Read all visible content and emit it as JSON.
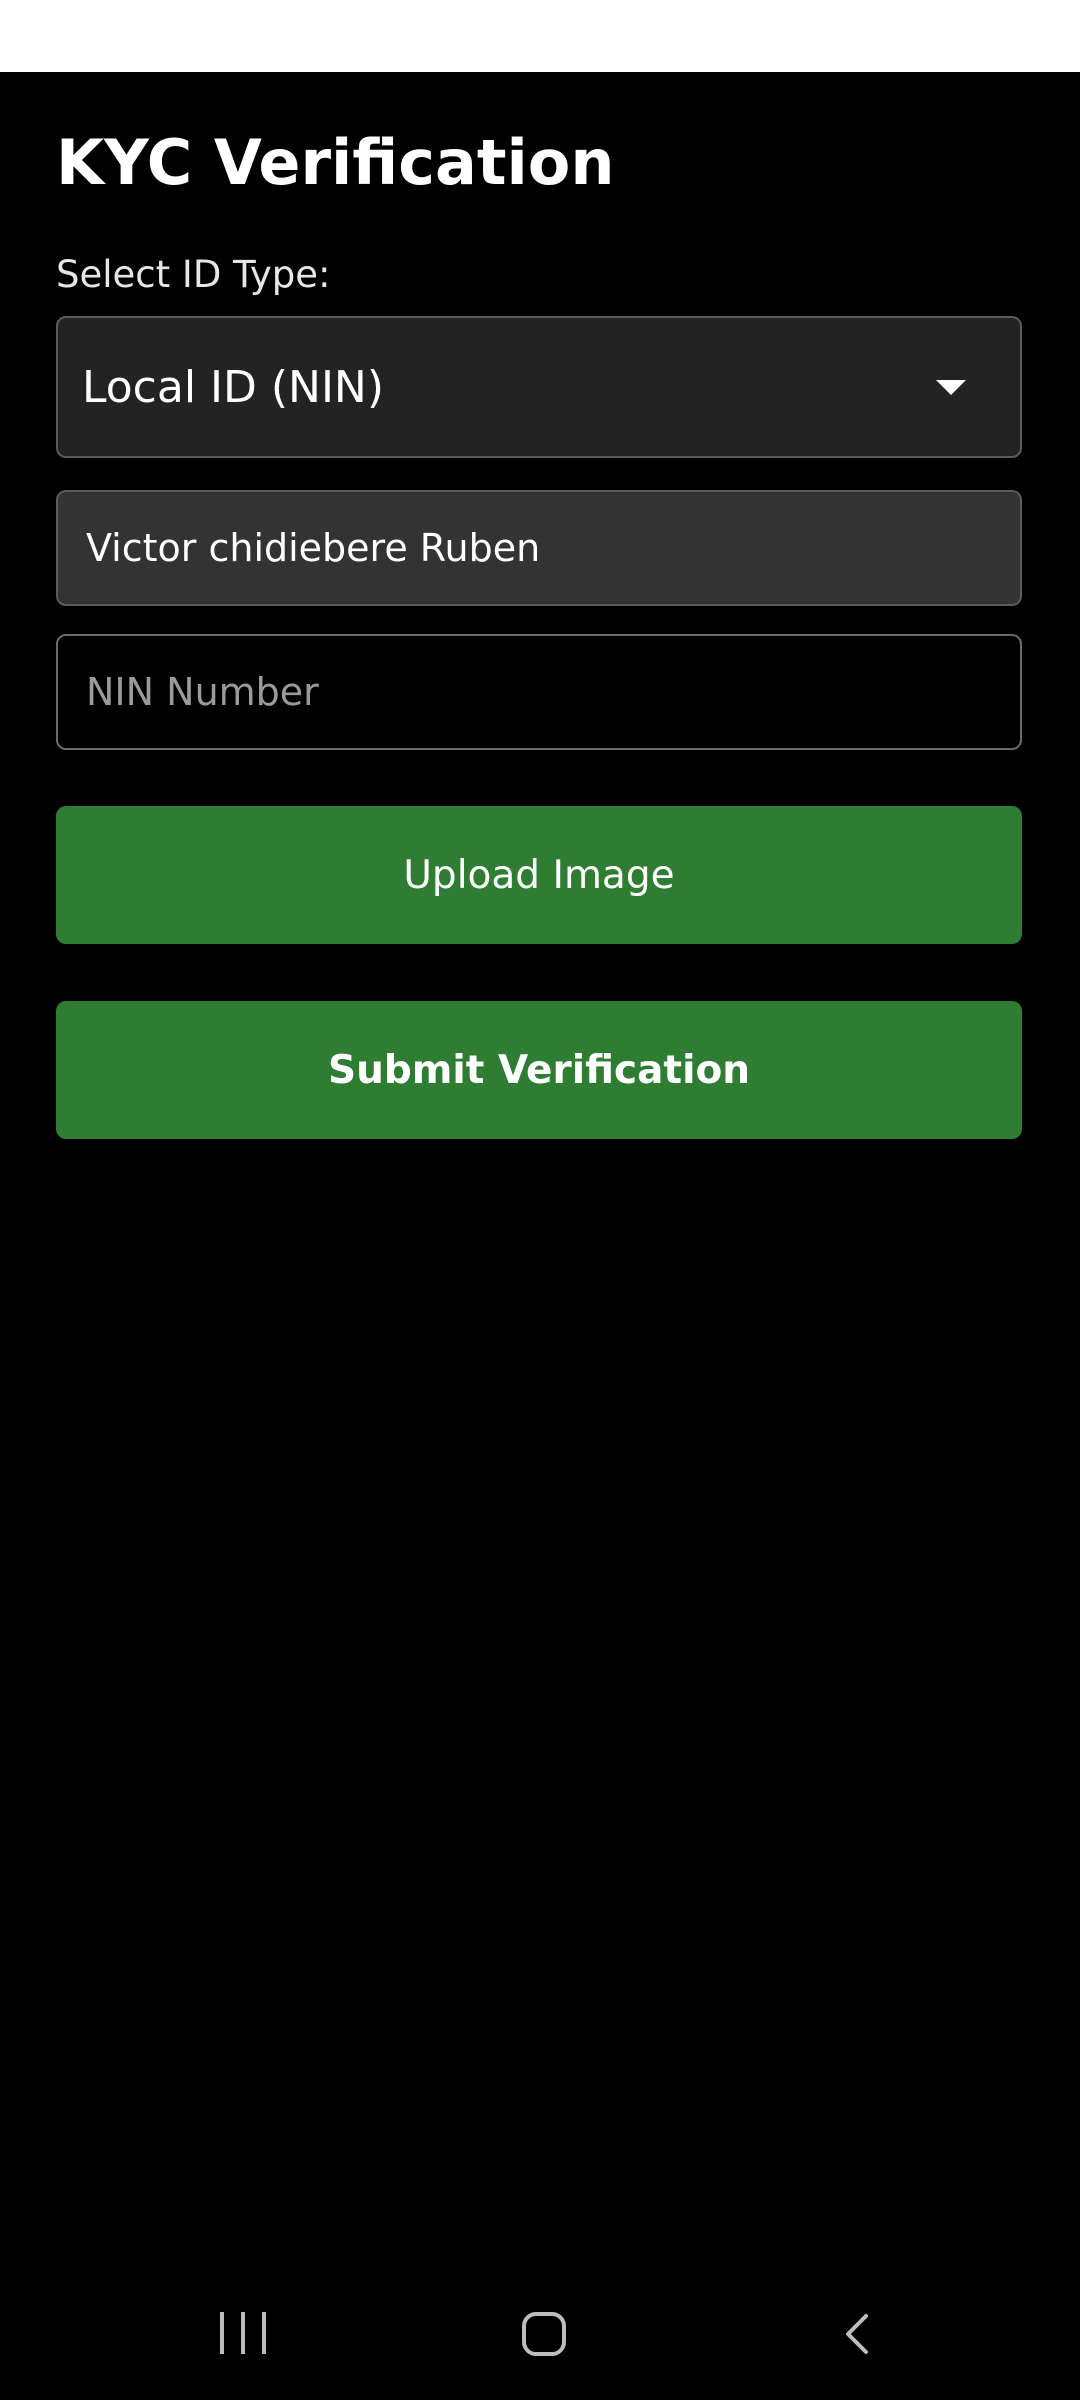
{
  "page": {
    "title": "KYC Verification"
  },
  "form": {
    "id_type_label": "Select ID Type:",
    "id_type_selected": "Local ID (NIN)",
    "full_name_value": "Victor chidiebere Ruben",
    "nin_placeholder": "NIN Number",
    "nin_value": ""
  },
  "buttons": {
    "upload_label": "Upload Image",
    "submit_label": "Submit Verification"
  },
  "colors": {
    "background": "#000000",
    "button_green": "#2e7d32",
    "dropdown_bg": "#232323",
    "name_field_bg": "#333333"
  },
  "icons": {
    "dropdown": "caret-down-icon",
    "nav_recents": "recents-icon",
    "nav_home": "home-icon",
    "nav_back": "back-icon"
  }
}
